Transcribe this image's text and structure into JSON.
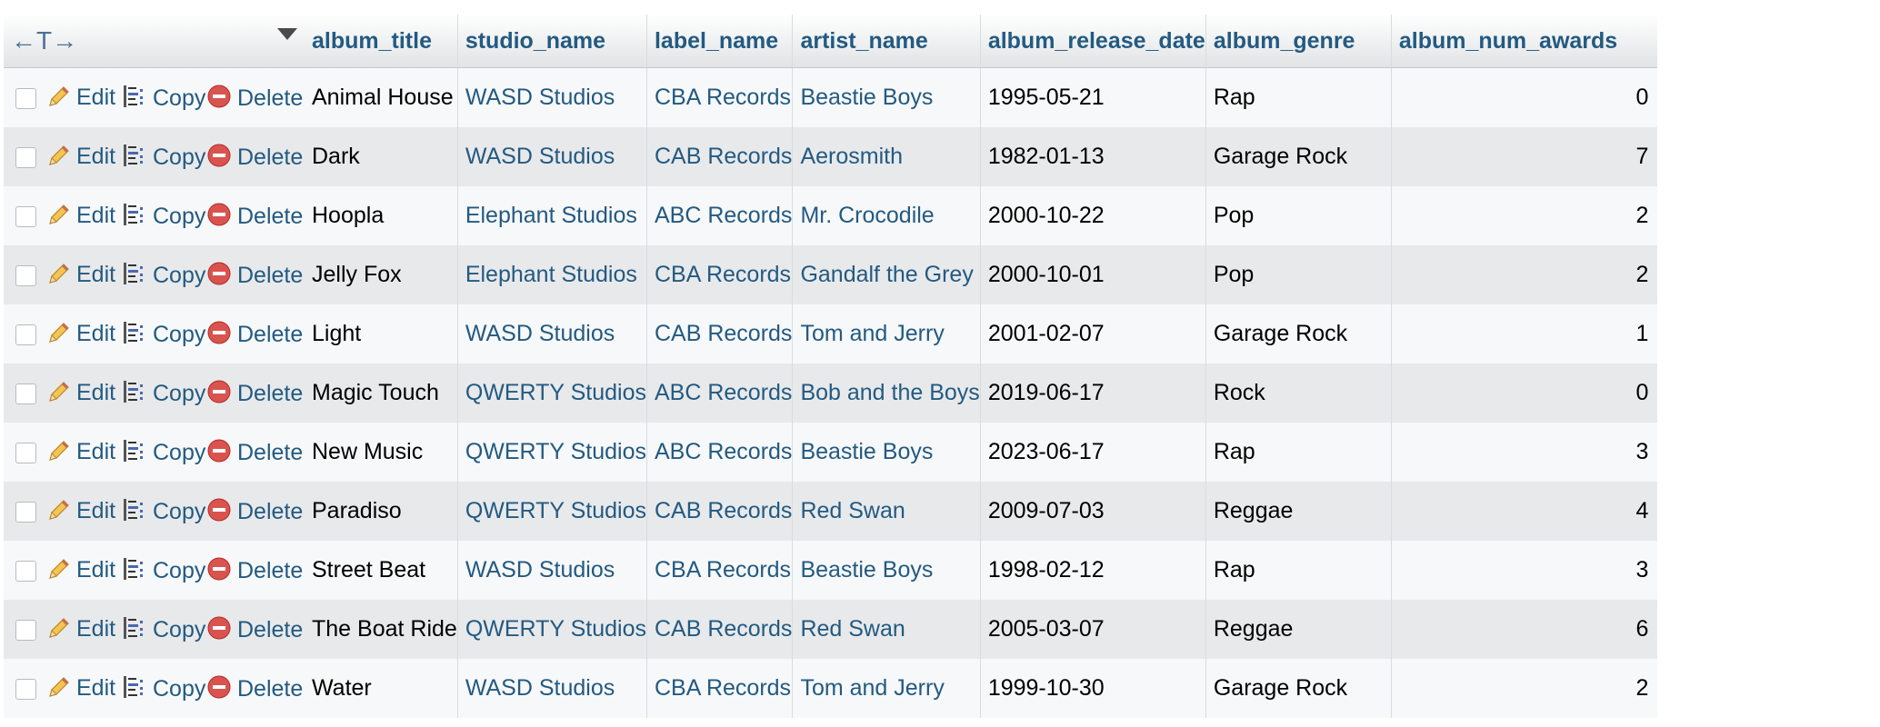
{
  "table": {
    "controls_icon": "column-arrows-icon",
    "columns": [
      "album_title",
      "studio_name",
      "label_name",
      "artist_name",
      "album_release_date",
      "album_genre",
      "album_num_awards"
    ],
    "actions": {
      "edit": "Edit",
      "copy": "Copy",
      "delete": "Delete"
    },
    "rows": [
      [
        "Animal House",
        "WASD Studios",
        "CBA Records",
        "Beastie Boys",
        "1995-05-21",
        "Rap",
        "0"
      ],
      [
        "Dark",
        "WASD Studios",
        "CAB Records",
        "Aerosmith",
        "1982-01-13",
        "Garage Rock",
        "7"
      ],
      [
        "Hoopla",
        "Elephant Studios",
        "ABC Records",
        "Mr. Crocodile",
        "2000-10-22",
        "Pop",
        "2"
      ],
      [
        "Jelly Fox",
        "Elephant Studios",
        "CBA Records",
        "Gandalf the Grey",
        "2000-10-01",
        "Pop",
        "2"
      ],
      [
        "Light",
        "WASD Studios",
        "CAB Records",
        "Tom and Jerry",
        "2001-02-07",
        "Garage Rock",
        "1"
      ],
      [
        "Magic Touch",
        "QWERTY Studios",
        "ABC Records",
        "Bob and the Boys",
        "2019-06-17",
        "Rock",
        "0"
      ],
      [
        "New Music",
        "QWERTY Studios",
        "ABC Records",
        "Beastie Boys",
        "2023-06-17",
        "Rap",
        "3"
      ],
      [
        "Paradiso",
        "QWERTY Studios",
        "CAB Records",
        "Red Swan",
        "2009-07-03",
        "Reggae",
        "4"
      ],
      [
        "Street Beat",
        "WASD Studios",
        "CBA Records",
        "Beastie Boys",
        "1998-02-12",
        "Rap",
        "3"
      ],
      [
        "The Boat Ride",
        "QWERTY Studios",
        "CAB Records",
        "Red Swan",
        "2005-03-07",
        "Reggae",
        "6"
      ],
      [
        "Water",
        "WASD Studios",
        "CBA Records",
        "Tom and Jerry",
        "1999-10-30",
        "Garage Rock",
        "2"
      ]
    ]
  },
  "colors": {
    "link": "#235a81",
    "row_odd": "#f7f8f9",
    "row_even": "#e8e9eb",
    "delete_icon": "#d9534f"
  }
}
